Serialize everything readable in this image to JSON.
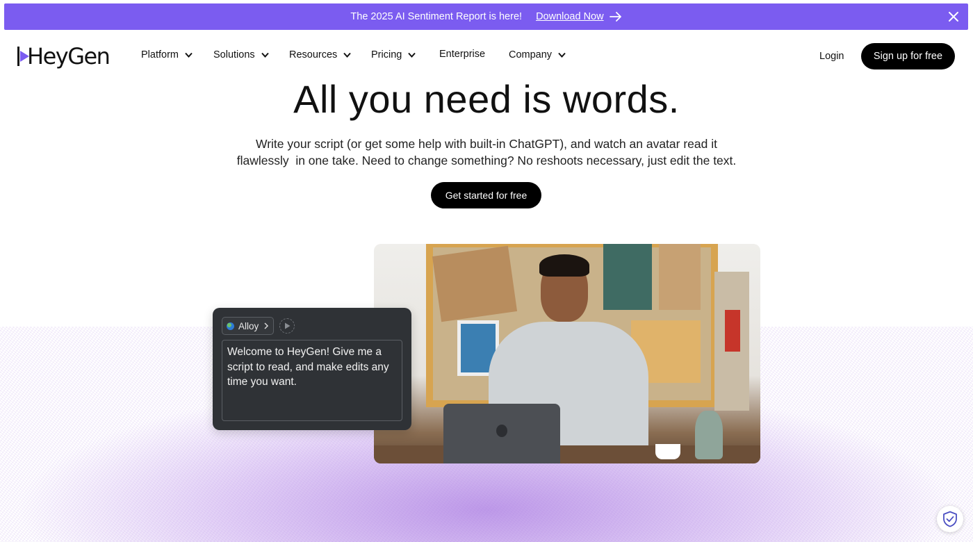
{
  "banner": {
    "message": "The 2025 AI Sentiment Report is here!",
    "link_label": "Download Now",
    "bg_color": "#7b5cf0"
  },
  "nav": {
    "logo_text": "HeyGen",
    "items": [
      {
        "label": "Platform",
        "has_dropdown": true
      },
      {
        "label": "Solutions",
        "has_dropdown": true
      },
      {
        "label": "Resources",
        "has_dropdown": true
      },
      {
        "label": "Pricing",
        "has_dropdown": true
      },
      {
        "label": "Enterprise",
        "has_dropdown": false
      },
      {
        "label": "Company",
        "has_dropdown": true
      }
    ],
    "login_label": "Login",
    "signup_label": "Sign up for free"
  },
  "hero": {
    "title": "All you need is words.",
    "subtitle_line1": "Write your script (or get some help with built-in ChatGPT), and watch an avatar read it",
    "subtitle_line2": "flawlessly  in one take. Need to change something? No reshoots necessary, just edit the text.",
    "cta_label": "Get started for free"
  },
  "editor": {
    "voice_name": "Alloy",
    "script_text": "Welcome to HeyGen! Give me a script to read, and make edits any time you want."
  },
  "icons": [
    "play-logo-icon",
    "arrow-right-icon",
    "close-icon",
    "chevron-down-icon",
    "globe-icon",
    "chevron-right-icon",
    "play-icon",
    "shield-check-icon"
  ]
}
